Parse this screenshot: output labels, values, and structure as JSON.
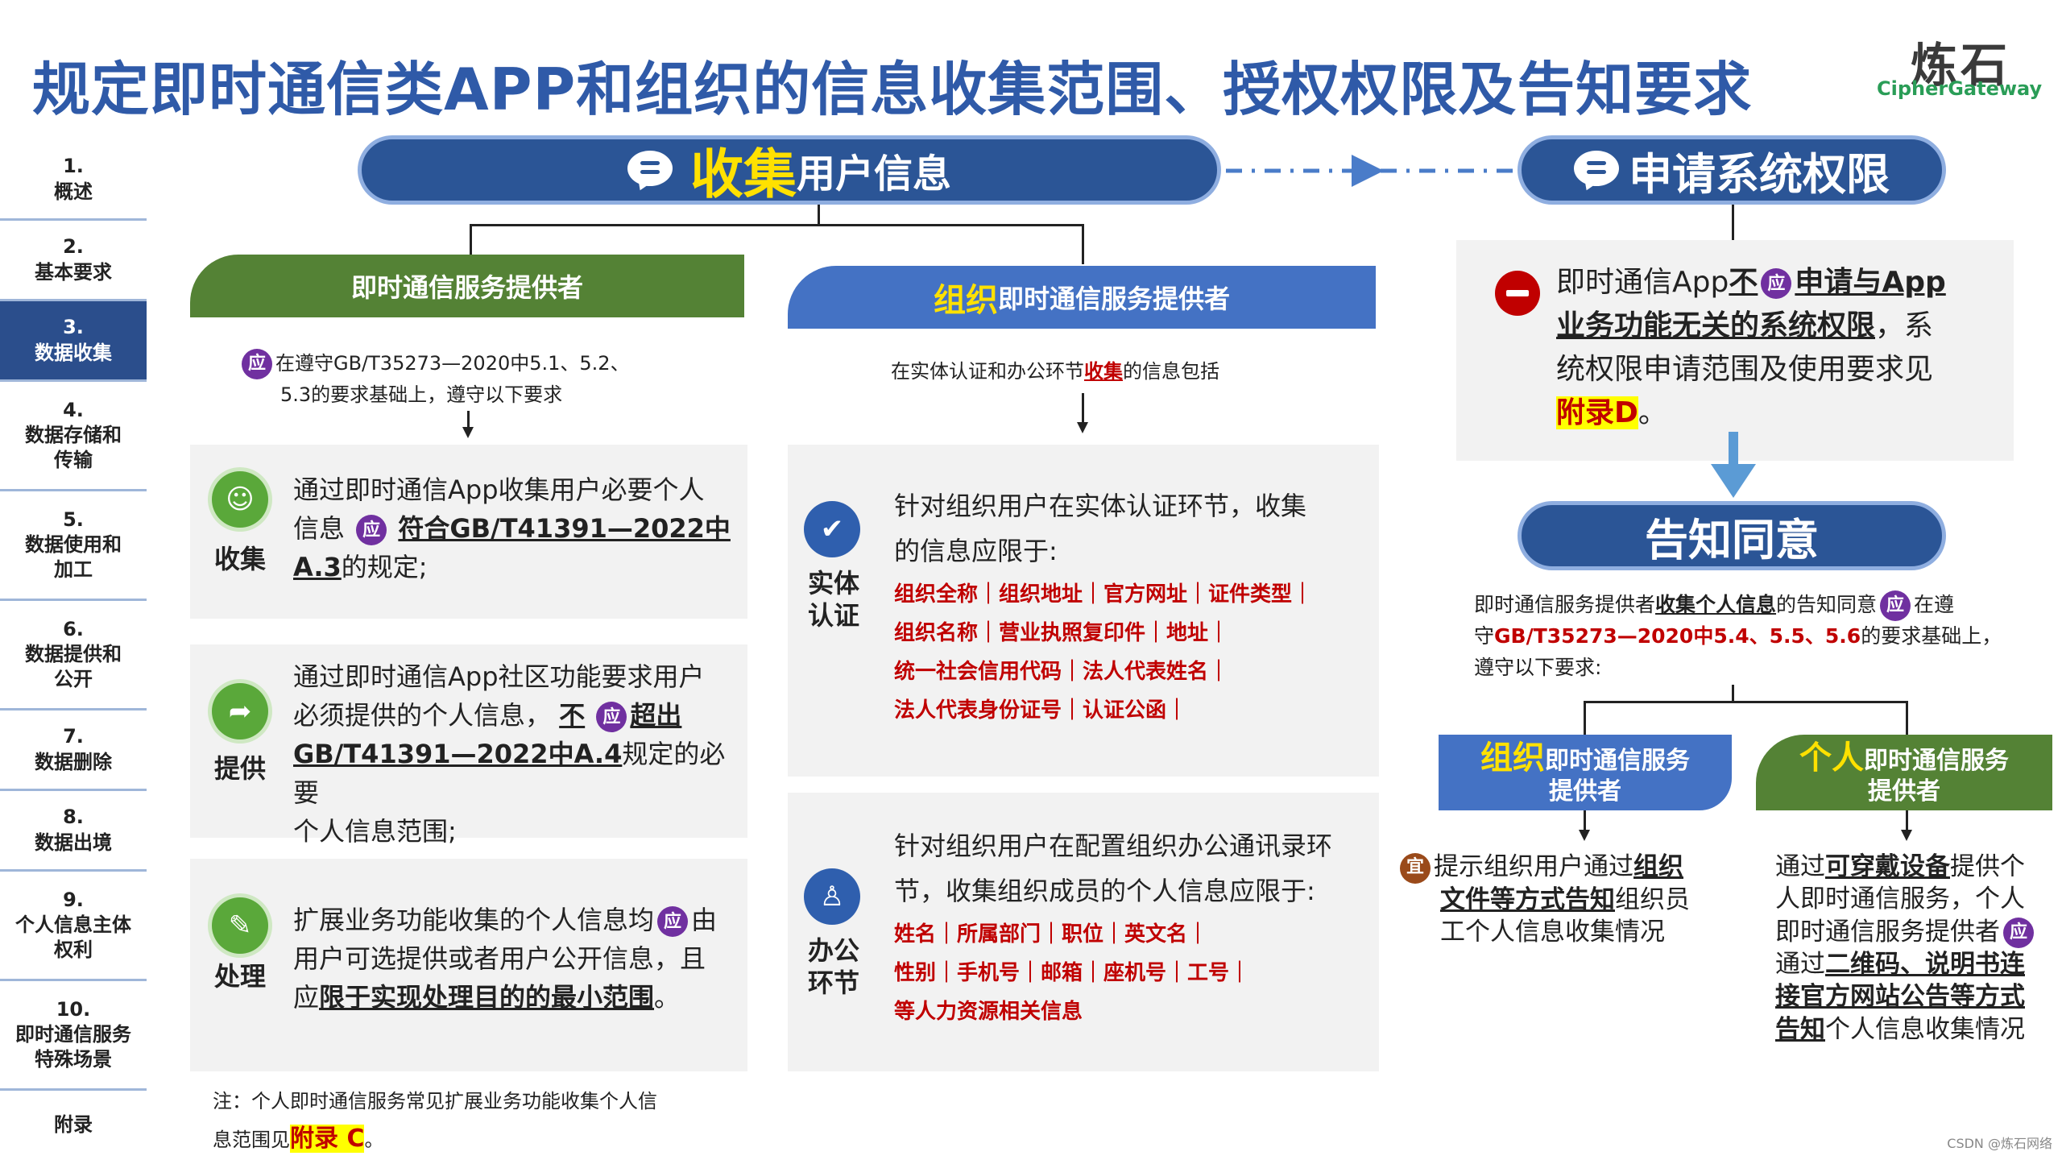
{
  "title": "规定即时通信类APP和组织的信息收集范围、授权权限及告知要求",
  "logo": {
    "cn": "炼石",
    "en": "CipherGateway"
  },
  "sidebar": [
    {
      "num": "1.",
      "label": "概述"
    },
    {
      "num": "2.",
      "label": "基本要求"
    },
    {
      "num": "3.",
      "label": "数据收集"
    },
    {
      "num": "4.",
      "label": "数据存储和传输"
    },
    {
      "num": "5.",
      "label": "数据使用和加工"
    },
    {
      "num": "6.",
      "label": "数据提供和公开"
    },
    {
      "num": "7.",
      "label": "数据删除"
    },
    {
      "num": "8.",
      "label": "数据出境"
    },
    {
      "num": "9.",
      "label": "个人信息主体权利"
    },
    {
      "num": "10.",
      "label": "即时通信服务特殊场景"
    },
    {
      "num": "",
      "label": "附录"
    }
  ],
  "collect_pill": {
    "highlight": "收集",
    "rest": "用户信息"
  },
  "permission_pill": "申请系统权限",
  "notice_pill": "告知同意",
  "left_header": "即时通信服务提供者",
  "left_intro": {
    "badge": "应",
    "line1": "在遵守GB/T35273—2020中5.1、5.2、",
    "line2": "5.3的要求基础上，遵守以下要求"
  },
  "left_boxes": [
    {
      "label": "收集",
      "t1": "通过即时通信App收集用户必要个人",
      "t2": "信息",
      "badge": "应",
      "u1": "符合GB/T41391—2022中",
      "u2": "A.3",
      "t3": "的规定;"
    },
    {
      "label": "提供",
      "t1": "通过即时通信App社区功能要求用户",
      "t2": "必须提供的个人信息，",
      "u0": "不",
      "badge": "应",
      "u1": "超出",
      "u2": "GB/T41391—2022中A.4",
      "t3": "规定的必要",
      "t4": "个人信息范围;"
    },
    {
      "label": "处理",
      "t1": "扩展业务功能收集的个人信息均",
      "badge": "应",
      "t2": "由",
      "t3": "用户可选提供或者用户公开信息，且",
      "t4": "应",
      "u1": "限于实现处理目的的最小范围",
      "t5": "。"
    }
  ],
  "left_note": {
    "t1": "注：个人即时通信服务常见扩展业务功能收集个人信",
    "t2": "息范围见",
    "hl": "附录 C",
    "t3": "。"
  },
  "mid_header": {
    "highlight": "组织",
    "rest": "即时通信服务提供者"
  },
  "mid_intro": {
    "t1": "在实体认证和办公环节",
    "u": "收集",
    "t2": "的信息包括"
  },
  "mid_boxes": [
    {
      "label1": "实体",
      "label2": "认证",
      "t1": "针对组织用户在实体认证环节，收集",
      "t2": "的信息应限于:",
      "tags": [
        "组织全称｜组织地址｜官方网址｜证件类型｜",
        "组织名称｜营业执照复印件｜地址｜",
        "统一社会信用代码｜法人代表姓名｜",
        "法人代表身份证号｜认证公函｜"
      ]
    },
    {
      "label1": "办公",
      "label2": "环节",
      "t1": "针对组织用户在配置组织办公通讯录环",
      "t2": "节，收集组织成员的个人信息应限于:",
      "tags": [
        "姓名｜所属部门｜职位｜英文名｜",
        "性别｜手机号｜邮箱｜座机号｜工号｜",
        "等人力资源相关信息"
      ]
    }
  ],
  "perm_box": {
    "t1": "即时通信App",
    "u1": "不",
    "badge": "应",
    "u2": "申请与App",
    "u3": "业务功能无关的系统权限",
    "t2": "，系",
    "t3": "统权限申请范围及使用要求见",
    "hl": "附录D",
    "t4": "。"
  },
  "notice_intro": {
    "t1": "即时通信服务提供者",
    "u": "收集个人信息",
    "t2": "的告知同意",
    "badge": "应",
    "t3": "在遵",
    "t4": "守",
    "r": "GB/T35273—2020中5.4、5.5、5.6",
    "t5": "的要求基础上，",
    "t6": "遵守以下要求:"
  },
  "org_header": {
    "highlight": "组织",
    "rest": "即时通信服务",
    "line2": "提供者"
  },
  "ind_header": {
    "highlight": "个人",
    "rest": "即时通信服务",
    "line2": "提供者"
  },
  "org_text": {
    "badge": "宜",
    "t1": "提示组织用户通过",
    "u1": "组织",
    "u2": "文件等方式告知",
    "t2": "组织员",
    "t3": "工个人信息收集情况"
  },
  "ind_text": {
    "t1": "通过",
    "u1": "可穿戴设备",
    "t2": "提供个",
    "t3": "人即时通信服务，个人",
    "t4": "即时通信服务提供者",
    "badge": "应",
    "t5": "通过",
    "u2": "二维码、说明书连",
    "u3": "接官方网站公告等方式",
    "u4": "告知",
    "t6": "个人信息收集情况"
  },
  "watermark": "CSDN @炼石网络",
  "colors": {
    "blue_pill": "#2b5596",
    "green": "#548235",
    "blue_header": "#4472c4",
    "red": "#c00000",
    "purple_badge": "#7030a0"
  }
}
